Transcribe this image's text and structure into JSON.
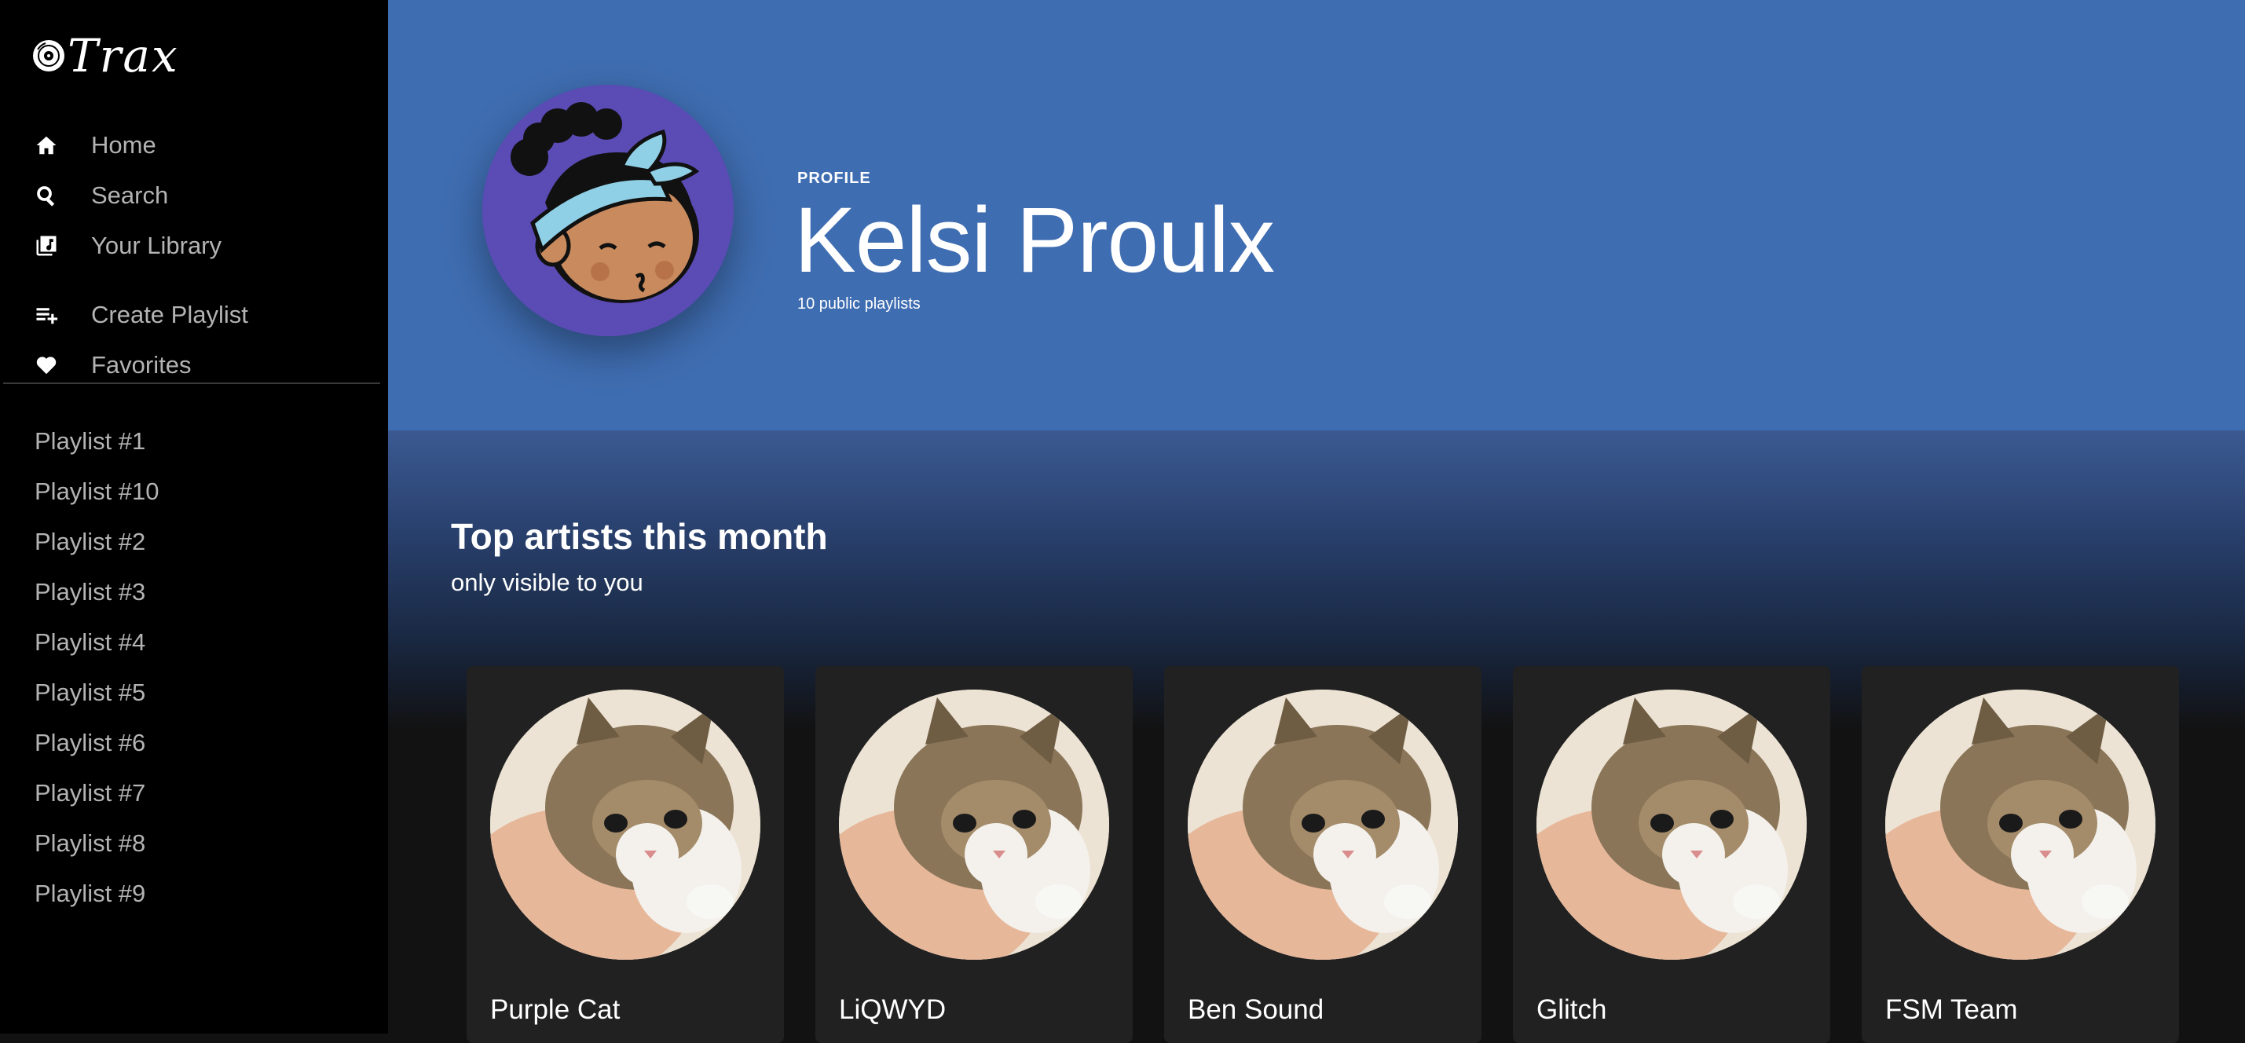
{
  "app": {
    "logo_text": "Trax",
    "logo_icon": "vinyl-disc-icon"
  },
  "sidebar": {
    "nav": [
      {
        "label": "Home",
        "icon": "home-icon"
      },
      {
        "label": "Search",
        "icon": "search-icon"
      },
      {
        "label": "Your Library",
        "icon": "library-icon"
      }
    ],
    "actions": [
      {
        "label": "Create Playlist",
        "icon": "playlist-add-icon"
      },
      {
        "label": "Favorites",
        "icon": "heart-icon"
      }
    ],
    "playlists": [
      "Playlist #1",
      "Playlist #10",
      "Playlist #2",
      "Playlist #3",
      "Playlist #4",
      "Playlist #5",
      "Playlist #6",
      "Playlist #7",
      "Playlist #8",
      "Playlist #9"
    ]
  },
  "profile": {
    "label": "PROFILE",
    "name": "Kelsi Proulx",
    "subtitle": "10 public playlists",
    "header_color": "#3f6db1",
    "avatar_bg": "#5a4bb5"
  },
  "top_artists": {
    "title": "Top artists this month",
    "subtitle": "only visible to you",
    "artists": [
      {
        "name": "Purple Cat"
      },
      {
        "name": "LiQWYD"
      },
      {
        "name": "Ben Sound"
      },
      {
        "name": "Glitch"
      },
      {
        "name": "FSM Team"
      }
    ]
  }
}
